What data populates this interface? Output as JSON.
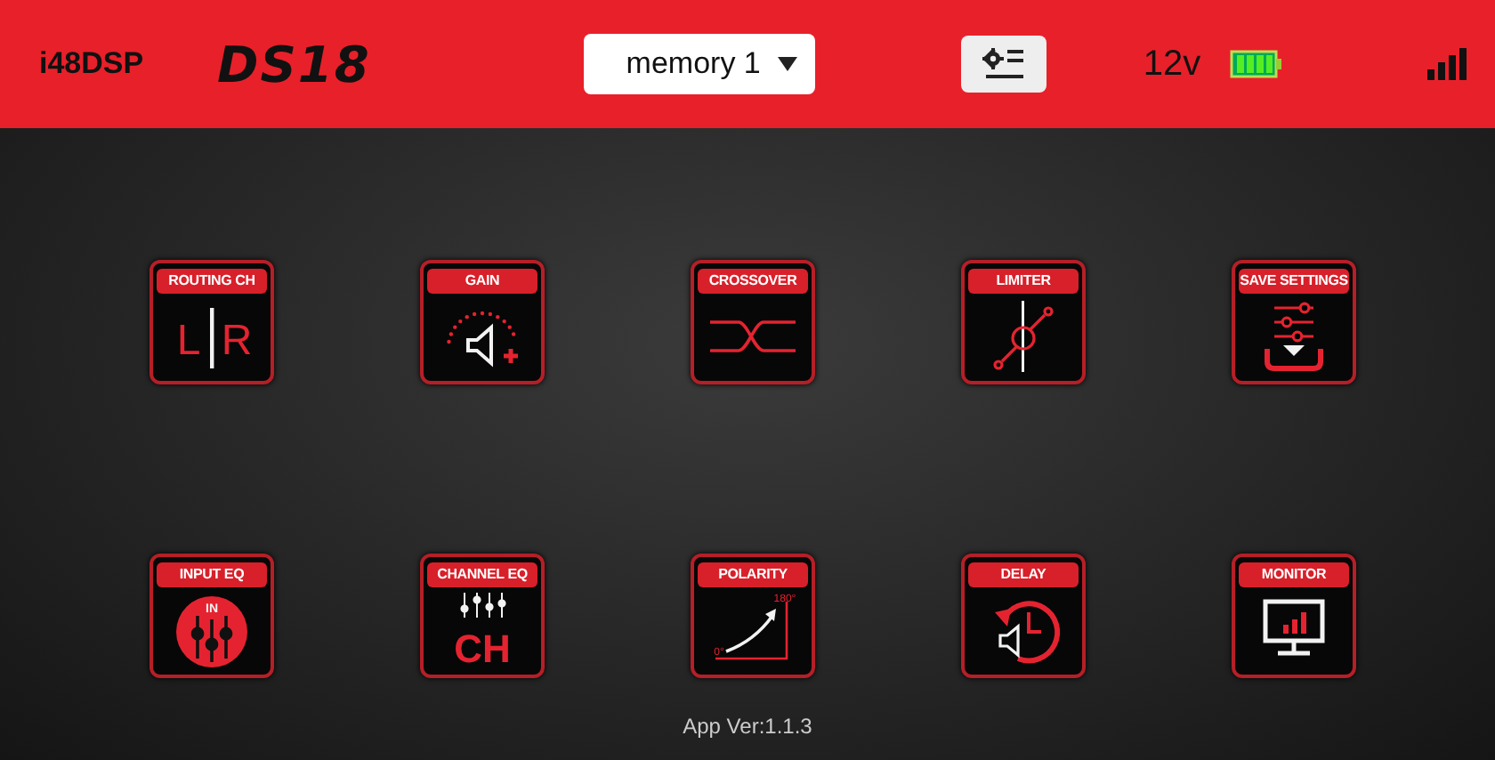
{
  "header": {
    "app_name": "i48DSP",
    "logo": "DS18",
    "preset": {
      "value": "memory 1"
    },
    "voltage": "12v"
  },
  "tiles": [
    {
      "kind": "routing",
      "label": "ROUTING CH",
      "glyphs": [
        "L",
        "R"
      ]
    },
    {
      "kind": "gain",
      "label": "GAIN"
    },
    {
      "kind": "crossover",
      "label": "CROSSOVER"
    },
    {
      "kind": "limiter",
      "label": "LIMITER"
    },
    {
      "kind": "save",
      "label": "SAVE SETTINGS"
    },
    {
      "kind": "inputeq",
      "label": "INPUT EQ",
      "glyphs": [
        "IN"
      ]
    },
    {
      "kind": "channeleq",
      "label": "CHANNEL EQ",
      "glyphs": [
        "CH"
      ]
    },
    {
      "kind": "polarity",
      "label": "POLARITY",
      "glyphs": [
        "180°",
        "0°"
      ]
    },
    {
      "kind": "delay",
      "label": "DELAY"
    },
    {
      "kind": "monitor",
      "label": "MONITOR"
    }
  ],
  "footer": {
    "version": "App Ver:1.1.3"
  }
}
